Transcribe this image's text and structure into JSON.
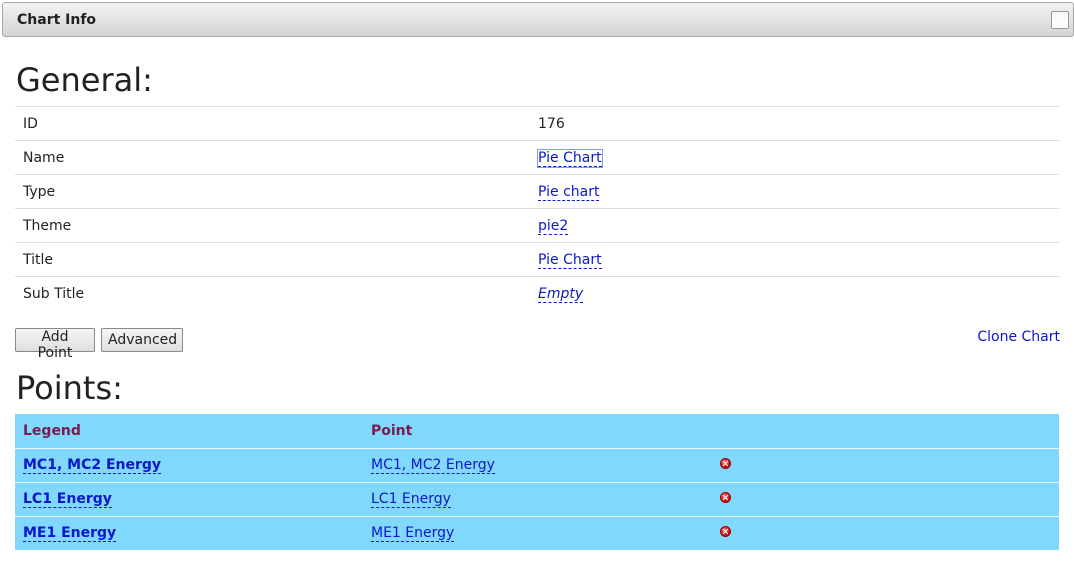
{
  "panel": {
    "title": "Chart Info"
  },
  "general": {
    "heading": "General:",
    "rows": [
      {
        "label": "ID",
        "value": "176"
      },
      {
        "label": "Name",
        "value": "Pie Chart"
      },
      {
        "label": "Type",
        "value": "Pie chart"
      },
      {
        "label": "Theme",
        "value": "pie2"
      },
      {
        "label": "Title",
        "value": "Pie Chart"
      },
      {
        "label": "Sub Title",
        "value": "Empty"
      }
    ]
  },
  "actions": {
    "add_point": "Add Point",
    "advanced": "Advanced",
    "clone_chart": "Clone Chart"
  },
  "points": {
    "heading": "Points:",
    "columns": [
      "Legend",
      "Point"
    ],
    "rows": [
      {
        "legend": "MC1, MC2 Energy",
        "point": "MC1, MC2 Energy"
      },
      {
        "legend": "LC1 Energy",
        "point": "LC1 Energy"
      },
      {
        "legend": "ME1 Energy",
        "point": "ME1 Energy"
      }
    ]
  },
  "colors": {
    "link": "#0c17c8",
    "points_background": "#80d8fc",
    "points_header_text": "#7b1a4e"
  },
  "icons": {
    "delete": "delete-icon",
    "collapse": "checkbox-icon"
  }
}
